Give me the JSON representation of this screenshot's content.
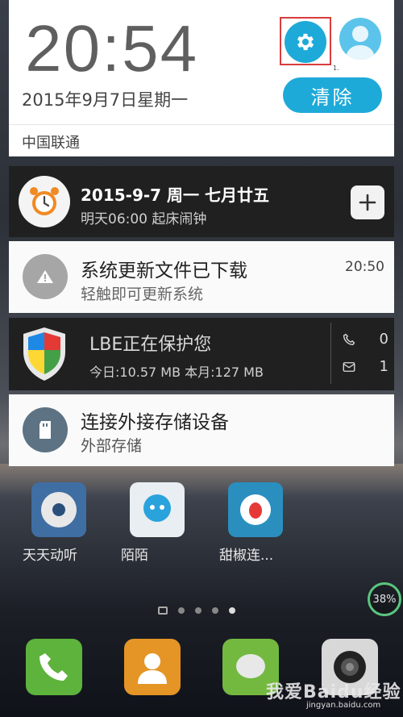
{
  "header": {
    "time": "20:54",
    "date": "2015年9月7日星期一",
    "clear_label": "清除",
    "settings_marker": "1.",
    "carrier": "中国联通"
  },
  "notifications": [
    {
      "title": "2015-9-7 周一 七月廿五",
      "subtitle": "明天06:00 起床闹钟",
      "icon": "alarm-clock-icon"
    },
    {
      "title": "系统更新文件已下载",
      "subtitle": "轻触即可更新系统",
      "time": "20:50",
      "icon": "warning-icon"
    },
    {
      "title": "LBE正在保护您",
      "subtitle": "今日:10.57 MB 本月:127 MB",
      "calls": "0",
      "messages": "1",
      "icon": "shield-icon"
    },
    {
      "title": "连接外接存储设备",
      "subtitle": "外部存储",
      "icon": "sd-card-icon"
    }
  ],
  "apps": [
    {
      "label": "天天动听"
    },
    {
      "label": "陌陌"
    },
    {
      "label": "甜椒连..."
    }
  ],
  "battery": "38%",
  "watermark": {
    "main": "我爱Baidu经验",
    "sub": "jingyan.baidu.com"
  },
  "colors": {
    "accent": "#1eaad8",
    "highlight_border": "#d93c3c"
  }
}
